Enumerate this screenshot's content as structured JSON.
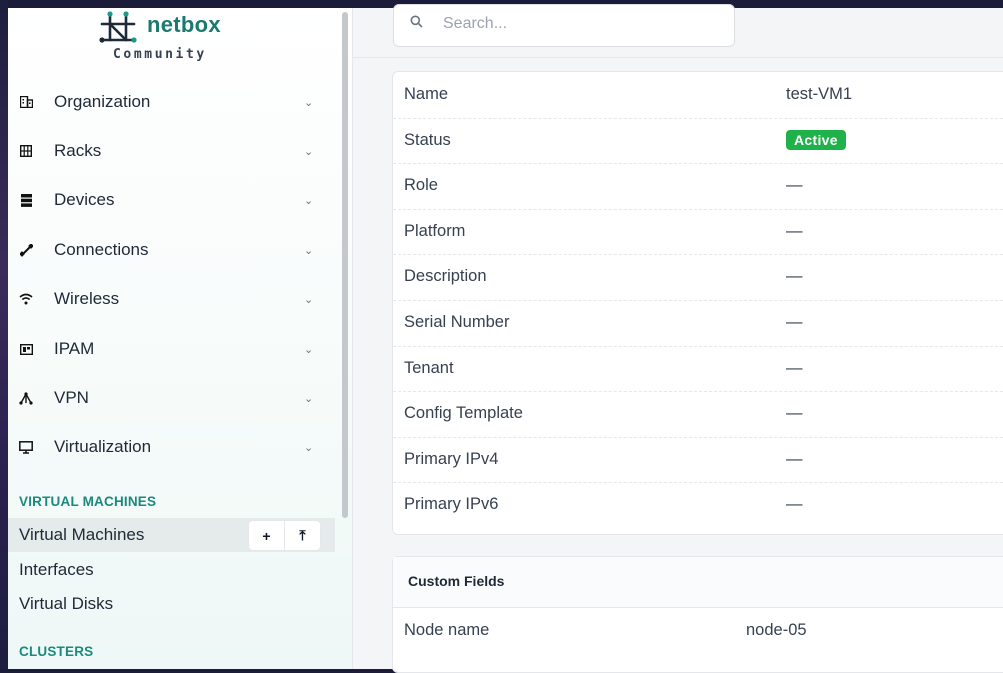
{
  "brand": {
    "name": "netbox",
    "edition": "Community"
  },
  "search": {
    "placeholder": "Search..."
  },
  "sidebar": {
    "menu": [
      {
        "label": "Organization",
        "icon": "building-icon"
      },
      {
        "label": "Racks",
        "icon": "rack-icon"
      },
      {
        "label": "Devices",
        "icon": "server-icon"
      },
      {
        "label": "Connections",
        "icon": "cable-icon"
      },
      {
        "label": "Wireless",
        "icon": "wifi-icon"
      },
      {
        "label": "IPAM",
        "icon": "ip-icon"
      },
      {
        "label": "VPN",
        "icon": "tunnel-icon"
      },
      {
        "label": "Virtualization",
        "icon": "monitor-icon"
      }
    ],
    "section_vm": "VIRTUAL MACHINES",
    "vm_items": [
      "Virtual Machines",
      "Interfaces",
      "Virtual Disks"
    ],
    "section_clusters": "CLUSTERS",
    "add_button": "+",
    "import_button": "⤒"
  },
  "details": {
    "rows": [
      {
        "label": "Name",
        "value": "test-VM1"
      },
      {
        "label": "Status",
        "value": "Active"
      },
      {
        "label": "Role",
        "value": "—"
      },
      {
        "label": "Platform",
        "value": "—"
      },
      {
        "label": "Description",
        "value": "—"
      },
      {
        "label": "Serial Number",
        "value": "—"
      },
      {
        "label": "Tenant",
        "value": "—"
      },
      {
        "label": "Config Template",
        "value": "—"
      },
      {
        "label": "Primary IPv4",
        "value": "—"
      },
      {
        "label": "Primary IPv6",
        "value": "—"
      }
    ],
    "status_color": "#1fb24a"
  },
  "custom_fields": {
    "title": "Custom Fields",
    "rows": [
      {
        "label": "Node name",
        "value": "node-05"
      }
    ]
  },
  "colors": {
    "accent": "#1a7a6f",
    "section": "#1a8a7e"
  }
}
